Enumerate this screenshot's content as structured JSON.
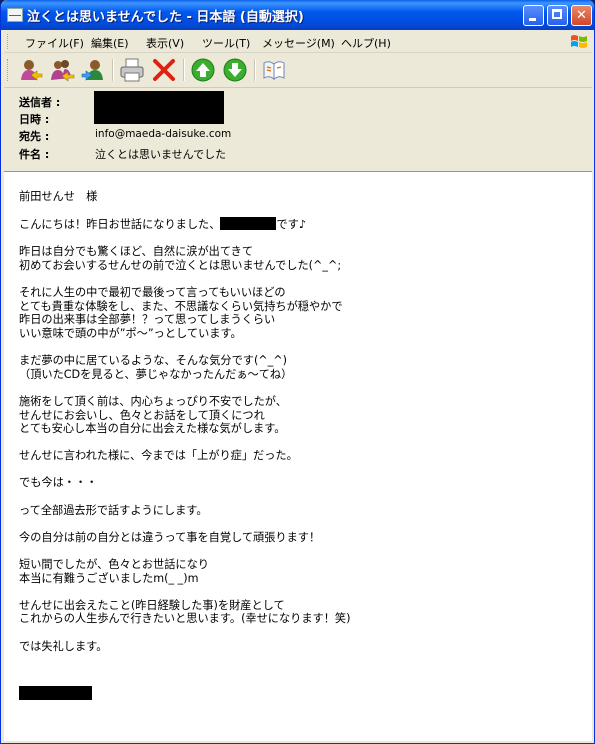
{
  "window": {
    "title": "泣くとは思いませんでした - 日本語 (自動選択)"
  },
  "menu": {
    "items": [
      "ファイル(F)",
      "編集(E)",
      "表示(V)",
      "ツール(T)",
      "メッセージ(M)",
      "ヘルプ(H)"
    ]
  },
  "toolbar": {
    "icons": [
      "reply-icon",
      "reply-all-icon",
      "forward-icon",
      "print-icon",
      "delete-icon",
      "previous-icon",
      "next-icon",
      "addresses-icon"
    ]
  },
  "header": {
    "from_label": "送信者 :",
    "date_label": "日時 :",
    "to_label": "宛先 :",
    "to_value": "info@maeda-daisuke.com",
    "subject_label": "件名 :",
    "subject_value": "泣くとは思いませんでした"
  },
  "message": {
    "greeting": "前田せんせ　様",
    "line1_pre": "こんにちは！昨日お世話になりました、",
    "line1_post": "です♪",
    "rest": "昨日は自分でも驚くほど、自然に涙が出てきて\n初めてお会いするせんせの前で泣くとは思いませんでした(^_^;\n\nそれに人生の中で最初で最後って言ってもいいほどの\nとても貴重な体験をし、また、不思議なくらい気持ちが穏やかで\n昨日の出来事は全部夢！？って思ってしまうくらい\nいい意味で頭の中が”ポ～”っとしています。\n\nまだ夢の中に居ているような、そんな気分です(^_^)\n（頂いたCDを見ると、夢じゃなかったんだぁ～てね）\n\n施術をして頂く前は、内心ちょっぴり不安でしたが、\nせんせにお会いし、色々とお話をして頂くにつれ\nとても安心し本当の自分に出会えた様な気がします。\n\nせんせに言われた様に、今までは「上がり症」だった。\n\nでも今は・・・\n\nって全部過去形で話すようにします。\n\n今の自分は前の自分とは違うって事を自覚して頑張ります！\n\n短い間でしたが、色々とお世話になり\n本当に有難うございましたm(_ _)m\n\nせんせに出会えたこと(昨日経験した事)を財産として\nこれからの人生歩んで行きたいと思います。(幸せになります！笑)\n\nでは失礼します。"
  },
  "colors": {
    "titlebar": "#0058ee",
    "chrome": "#ece9d8",
    "close": "#d2472a"
  }
}
